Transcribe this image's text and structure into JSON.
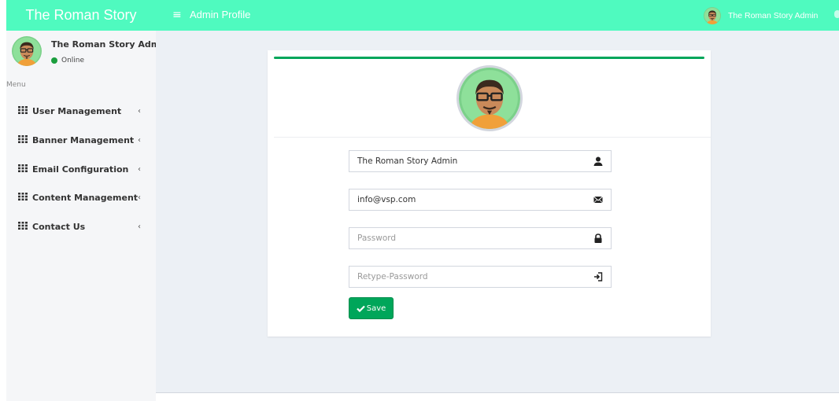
{
  "app": {
    "brand": "The Roman Story",
    "page_title": "Admin Profile"
  },
  "topbar": {
    "menu_glyph": "≡",
    "user_name": "The Roman Story Admin"
  },
  "sidebar": {
    "user_name": "The Roman Story Admin",
    "status": "Online",
    "status_color": "#1b9e3e",
    "menu_header": "Menu",
    "items": [
      {
        "label": "User Management",
        "icon": "grid-icon",
        "chevron": "‹"
      },
      {
        "label": "Banner Management",
        "icon": "grid-icon",
        "chevron": "‹"
      },
      {
        "label": "Email Configuration",
        "icon": "grid-icon",
        "chevron": "‹"
      },
      {
        "label": "Content Management",
        "icon": "grid-icon",
        "chevron": "‹"
      },
      {
        "label": "Contact Us",
        "icon": "grid-icon",
        "chevron": "‹"
      }
    ]
  },
  "form": {
    "name": {
      "value": "The Roman Story Admin",
      "icon": "user-icon"
    },
    "email": {
      "value": "info@vsp.com",
      "icon": "envelope-icon"
    },
    "password": {
      "placeholder": "Password",
      "icon": "lock-icon"
    },
    "retype": {
      "placeholder": "Retype-Password",
      "icon": "login-icon"
    },
    "save_label": "Save"
  },
  "colors": {
    "topbar": "#4ffabf",
    "accent": "#00a65a",
    "content_bg": "#ecf0f5",
    "sidebar_bg": "#f5f6f8"
  }
}
